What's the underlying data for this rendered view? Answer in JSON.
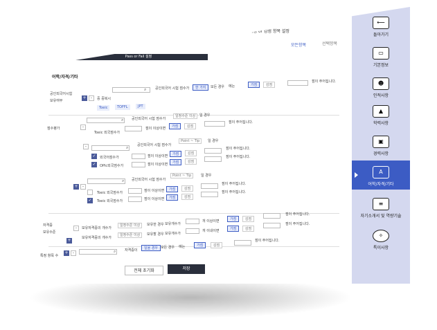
{
  "header": {
    "title": "가점 or 감점 항목 설정",
    "tab_all": "모든항목",
    "tab_selected": "선택항목",
    "dark_bar": "Pass or Fail 설정"
  },
  "section_title": "어학/자격/기타",
  "left_labels": {
    "official_lang": "공인외국어시험",
    "holding": "보유여부",
    "score": "점수평가",
    "cert": "자격증",
    "cert_holding": "보유수준",
    "special": "특정 항목 수"
  },
  "row1": {
    "multiselect": "중 중복시",
    "q": "공인외국어 시험 점수가",
    "opt_dup": "한 가지",
    "plain1": "모든 경우",
    "plain2": "경우 지원",
    "suffix": "에는",
    "bonus_btn": "가점",
    "minus_btn": "감점",
    "result": "점이 주어집니다.",
    "tags": [
      "Toeic",
      "TOFFL",
      "JPT"
    ]
  },
  "row2": {
    "q": "공인외국어 시험 점수가",
    "select": "일정수준 이상",
    "cond": "일 경우",
    "toeic": "Toeic 외국점수가",
    "range": "점이 이상이면",
    "bonus_btn": "가점",
    "minus_btn": "감점",
    "result": "점이 주어집니다."
  },
  "row3": {
    "q": "공인외국어 시험 점수가",
    "select": "Point ~ Tip",
    "cond": "일 경우",
    "l1": "외국어점수가",
    "l2": "OPIc외국점수가",
    "range": "점이 이상이면",
    "bonus_btn": "가점",
    "minus_btn": "감점",
    "result": "점이 주어집니다."
  },
  "row4": {
    "q": "공인외국어 시험 점수가",
    "select": "Point ~ Tip",
    "cond": "일 경우",
    "l1": "Toeic 외국점수가",
    "l2": "Toeic 외국점수가",
    "range": "점이 이상이면",
    "bonus_btn": "가점",
    "minus_btn": "감점",
    "result": "점이 주어집니다."
  },
  "row5": {
    "label1": "보유자격증의 개수가",
    "select1": "일정수준 이상",
    "mid1": "보유한 경우",
    "mid1b": "보유개수가",
    "range": "개 이상이면",
    "label2": "보유자격증의 개수가",
    "select2": "일정수준 이상",
    "mid2": "보유할 경우",
    "mid2b": "보유개수가",
    "range2": "개 이내이면",
    "bonus_btn": "가점",
    "minus_btn": "감점",
    "result": "점이 주어집니다."
  },
  "row6": {
    "q": "자격증이",
    "opt1": "일을 경우",
    "opt2": "모든 경우",
    "suffix": "에는",
    "bonus_btn": "가점",
    "minus_btn": "감점",
    "result": "점이 주어집니다."
  },
  "footer": {
    "reset": "전체 초기화",
    "save": "저장"
  },
  "sidebar": [
    {
      "label": "돌아가기",
      "icon": "back-arrow-icon",
      "glyph": "⟵"
    },
    {
      "label": "기본정보",
      "icon": "id-card-icon",
      "glyph": "▭"
    },
    {
      "label": "인적사항",
      "icon": "person-icon",
      "glyph": "☻"
    },
    {
      "label": "학력사항",
      "icon": "graduation-cap-icon",
      "glyph": "▲"
    },
    {
      "label": "경력사항",
      "icon": "briefcase-icon",
      "glyph": "▣"
    },
    {
      "label": "어학/자격/기타",
      "icon": "language-icon",
      "glyph": "A"
    },
    {
      "label": "자기소개서 및 역량기술",
      "icon": "document-icon",
      "glyph": "≡"
    },
    {
      "label": "특이사항",
      "icon": "lightbulb-icon",
      "glyph": "✧"
    }
  ]
}
